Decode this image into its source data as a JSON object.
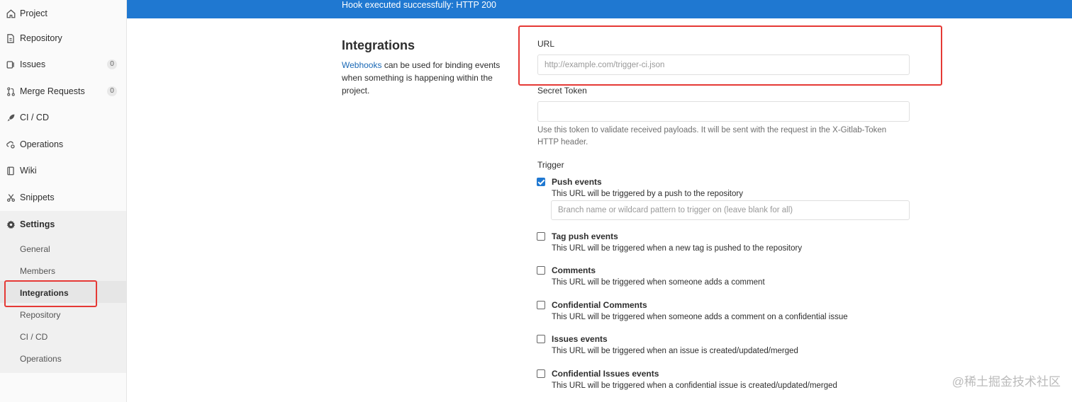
{
  "flash": {
    "message": "Hook executed successfully: HTTP 200"
  },
  "sidebar": {
    "items": [
      {
        "label": "Project",
        "icon": "home-icon"
      },
      {
        "label": "Repository",
        "icon": "file-icon"
      },
      {
        "label": "Issues",
        "icon": "issues-icon",
        "count": "0"
      },
      {
        "label": "Merge Requests",
        "icon": "merge-request-icon",
        "count": "0"
      },
      {
        "label": "CI / CD",
        "icon": "rocket-icon"
      },
      {
        "label": "Operations",
        "icon": "cloud-gear-icon"
      },
      {
        "label": "Wiki",
        "icon": "book-icon"
      },
      {
        "label": "Snippets",
        "icon": "scissors-icon"
      },
      {
        "label": "Settings",
        "icon": "gear-icon"
      }
    ],
    "settings_sub": [
      "General",
      "Members",
      "Integrations",
      "Repository",
      "CI / CD",
      "Operations"
    ],
    "active_sub": "Integrations"
  },
  "intro": {
    "title": "Integrations",
    "link_text": "Webhooks",
    "text": " can be used for binding events when something is happening within the project."
  },
  "form": {
    "url_label": "URL",
    "url_placeholder": "http://example.com/trigger-ci.json",
    "token_label": "Secret Token",
    "token_value": "",
    "token_help": "Use this token to validate received payloads. It will be sent with the request in the X-Gitlab-Token HTTP header.",
    "trigger_label": "Trigger",
    "branch_placeholder": "Branch name or wildcard pattern to trigger on (leave blank for all)",
    "triggers": [
      {
        "title": "Push events",
        "desc": "This URL will be triggered by a push to the repository",
        "checked": true
      },
      {
        "title": "Tag push events",
        "desc": "This URL will be triggered when a new tag is pushed to the repository",
        "checked": false
      },
      {
        "title": "Comments",
        "desc": "This URL will be triggered when someone adds a comment",
        "checked": false
      },
      {
        "title": "Confidential Comments",
        "desc": "This URL will be triggered when someone adds a comment on a confidential issue",
        "checked": false
      },
      {
        "title": "Issues events",
        "desc": "This URL will be triggered when an issue is created/updated/merged",
        "checked": false
      },
      {
        "title": "Confidential Issues events",
        "desc": "This URL will be triggered when a confidential issue is created/updated/merged",
        "checked": false
      }
    ]
  },
  "watermark": "@稀土掘金技术社区",
  "colors": {
    "accent": "#1f78d1",
    "highlight": "#e53935",
    "link": "#1b69b6"
  }
}
